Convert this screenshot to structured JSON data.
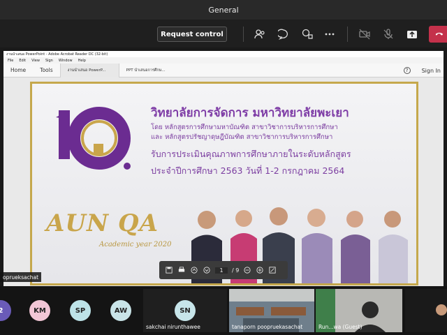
{
  "window": {
    "title": "General"
  },
  "controls": {
    "request_control_label": "Request control",
    "icons": [
      "participants-icon",
      "chat-icon",
      "reactions-icon",
      "more-icon",
      "camera-off-icon",
      "mic-off-icon",
      "share-icon",
      "hang-up-icon"
    ]
  },
  "acrobat": {
    "title_bar": "งานนำเสนอ PowerPoint - Adobe Acrobat Reader DC (32-bit)",
    "menu": [
      "File",
      "Edit",
      "View",
      "Sign",
      "Window",
      "Help"
    ],
    "tabs": [
      "Home",
      "Tools"
    ],
    "doc_tabs": [
      "งานนำเสนอ PowerP...",
      "PPT นำเสนอการศึกษ..."
    ],
    "sign_in": "Sign In"
  },
  "slide": {
    "line1": "วิทยาลัยการจัดการ มหาวิทยาลัยพะเยา",
    "line2": "โดย หลักสูตรการศึกษามหาบัณฑิต สาขาวิชาการบริหารการศึกษา",
    "line3": "และ หลักสูตรปรัชญาดุษฎีบัณฑิต สาขาวิชาการบริหารการศึกษา",
    "line4": "รับการประเมินคุณภาพการศึกษาภายในระดับหลักสูตร",
    "line5": "ประจำปีการศึกษา 2563 วันที่ 1-2 กรกฎาคม 2564",
    "logo_number": "10",
    "aun": "AUN QA",
    "academic_year": "Academic year 2020"
  },
  "pdf_toolbar": {
    "page_current": "1",
    "page_total": "/ 9"
  },
  "presenter": "oprueksachat",
  "participants": [
    {
      "initials": "2",
      "color": "#6a5bb8"
    },
    {
      "initials": "KM",
      "color": "#f2c6d6"
    },
    {
      "initials": "SP",
      "color": "#bde3e8"
    },
    {
      "initials": "AW",
      "color": "#c9e4e8"
    },
    {
      "initials": "SN",
      "color": "#c7e5ea",
      "name": "sakchai nirunthawee"
    }
  ],
  "video_tiles": [
    {
      "name": "tanaporn poopruekasachat"
    },
    {
      "name": "Run...wa (Guest)"
    }
  ]
}
